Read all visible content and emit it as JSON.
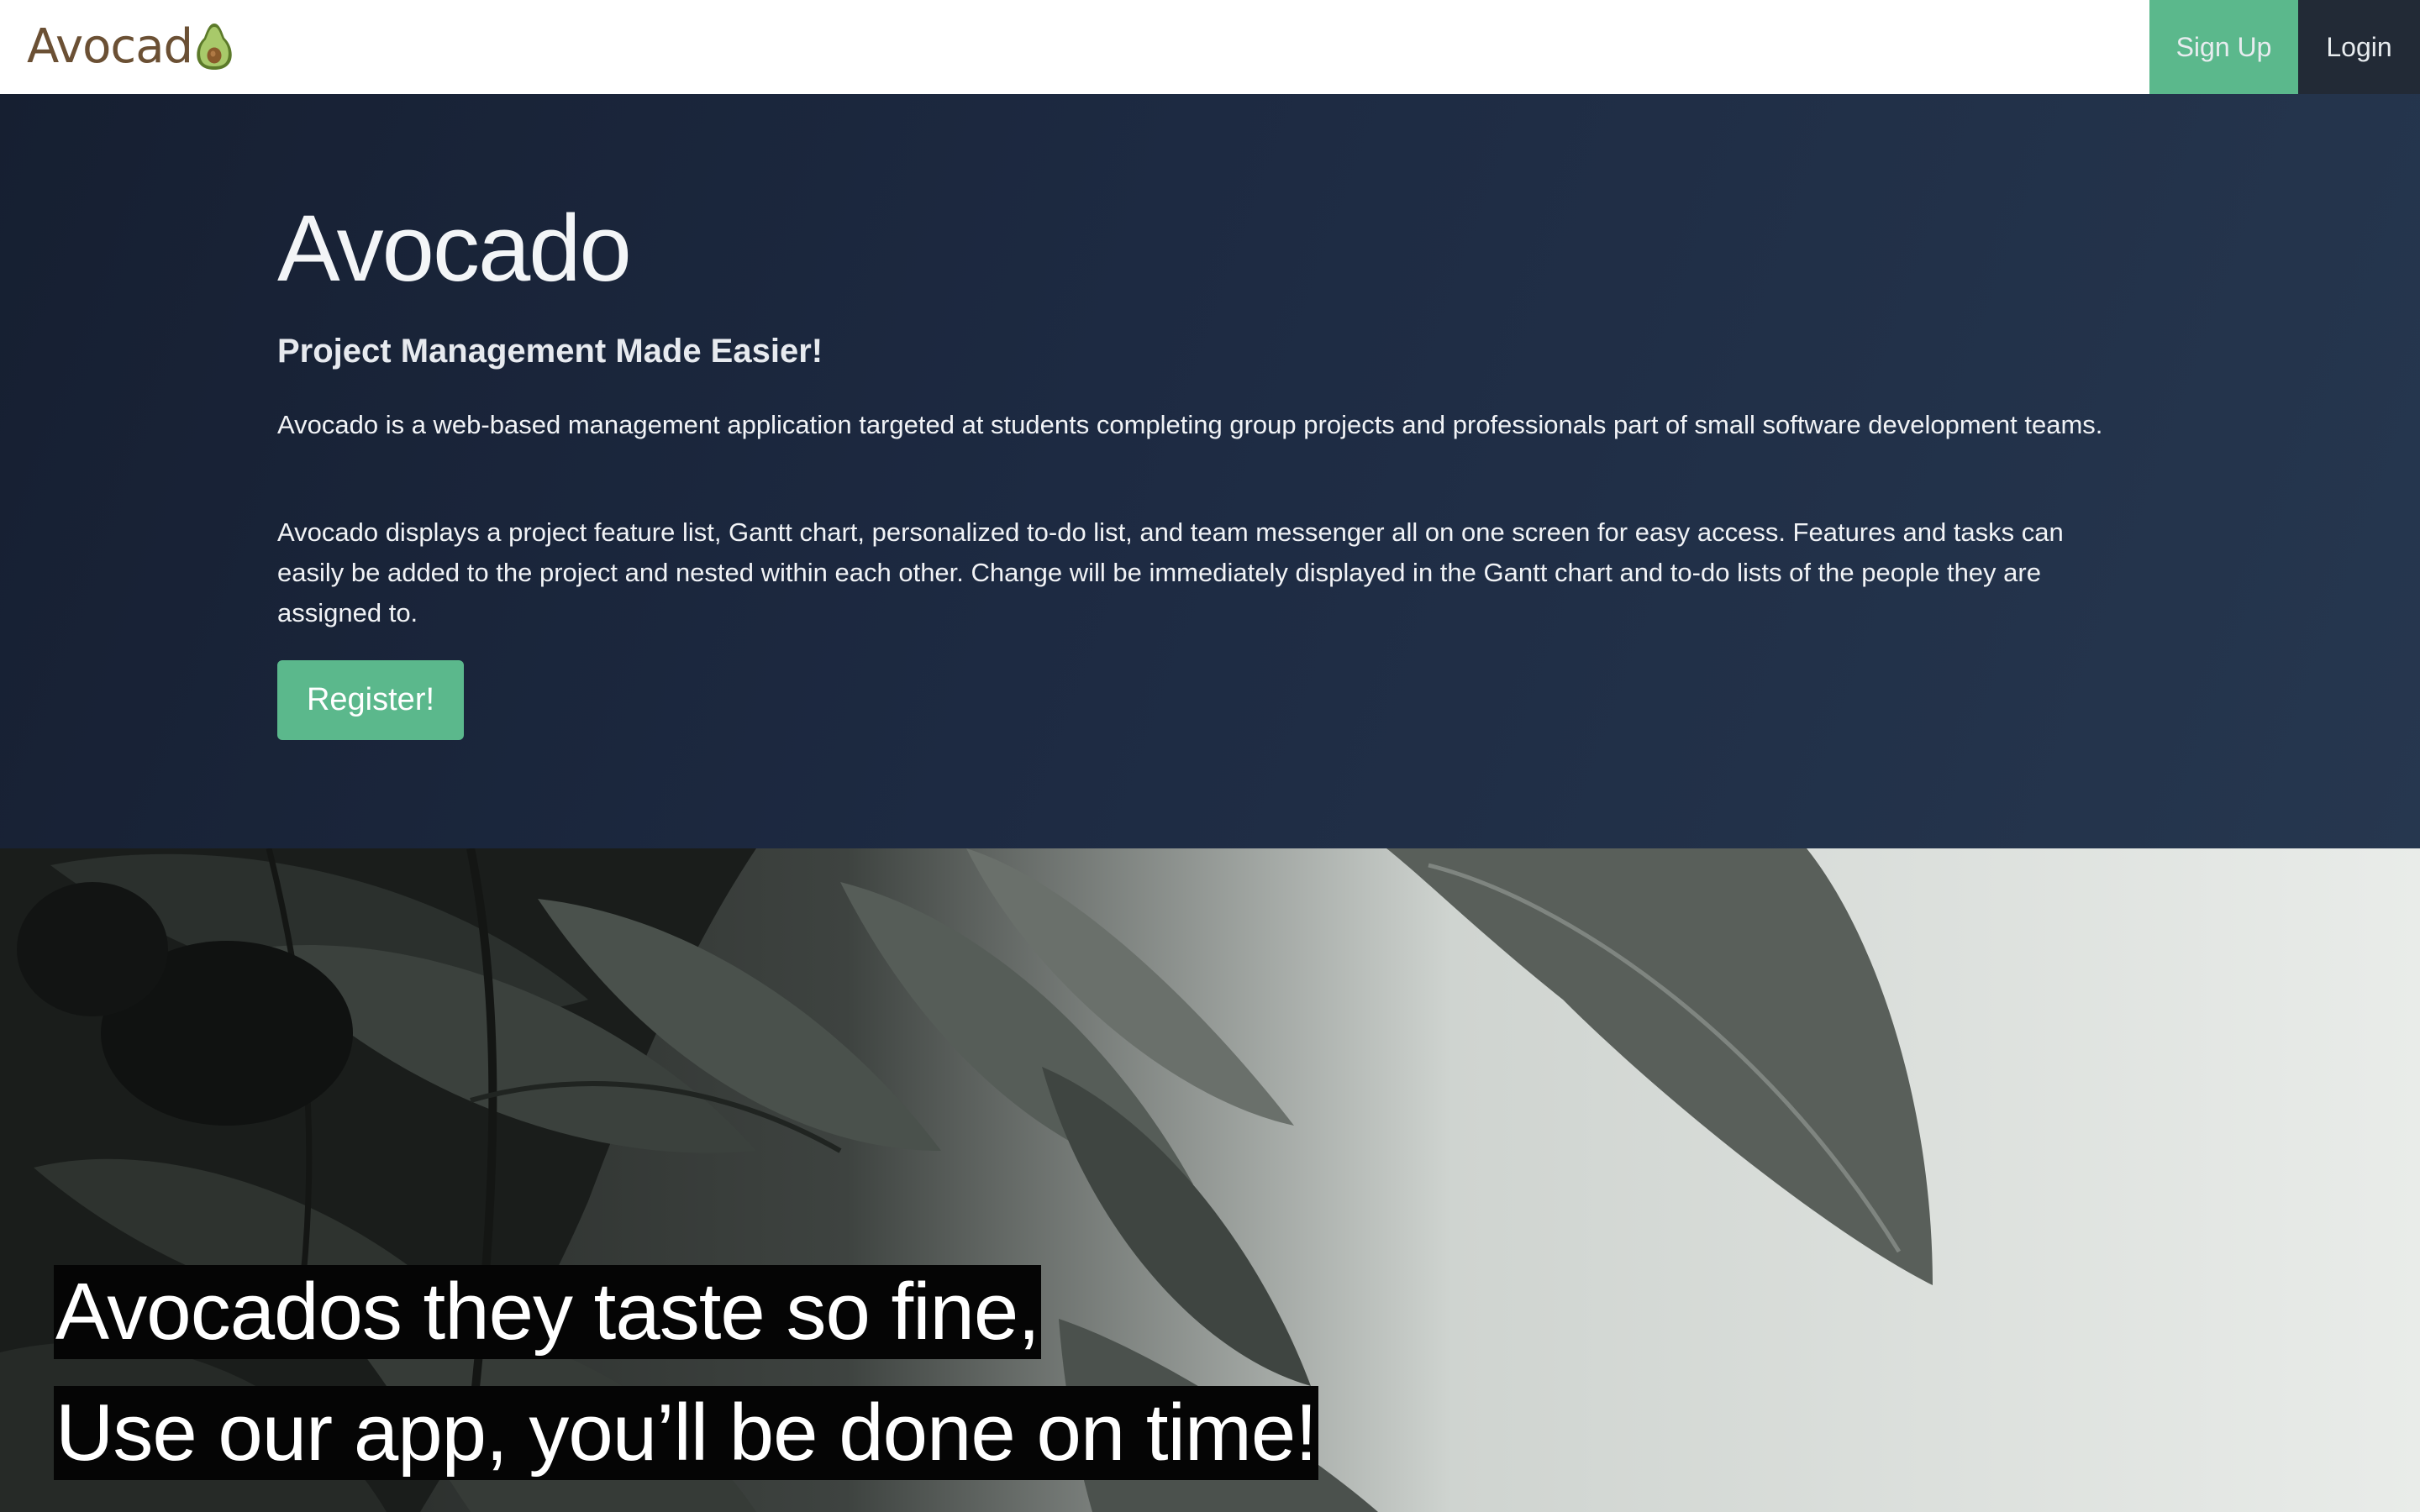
{
  "navbar": {
    "brand_text": "Avocad",
    "brand_logo_icon": "avocado-icon",
    "signup_label": "Sign Up",
    "login_label": "Login"
  },
  "hero": {
    "title": "Avocado",
    "subtitle": "Project Management Made Easier!",
    "paragraph1": "Avocado is a web-based management application targeted at students completing group projects and professionals part of small software development teams.",
    "paragraph2": "Avocado displays a project feature list, Gantt chart, personalized to-do list, and team messenger all on one screen for easy access. Features and tasks can easily be added to the project and nested within each other. Change will be immediately displayed in the Gantt chart and to-do lists of the people they are assigned to.",
    "register_label": "Register!"
  },
  "photo_section": {
    "tagline_line1": "Avocados they taste so fine,",
    "tagline_line2": "Use our app, you’ll be done on time!"
  },
  "colors": {
    "accent_green": "#5bb88c",
    "login_bg": "#222a36",
    "hero_bg": "#1d2a42",
    "brand_brown": "#6b5034"
  }
}
